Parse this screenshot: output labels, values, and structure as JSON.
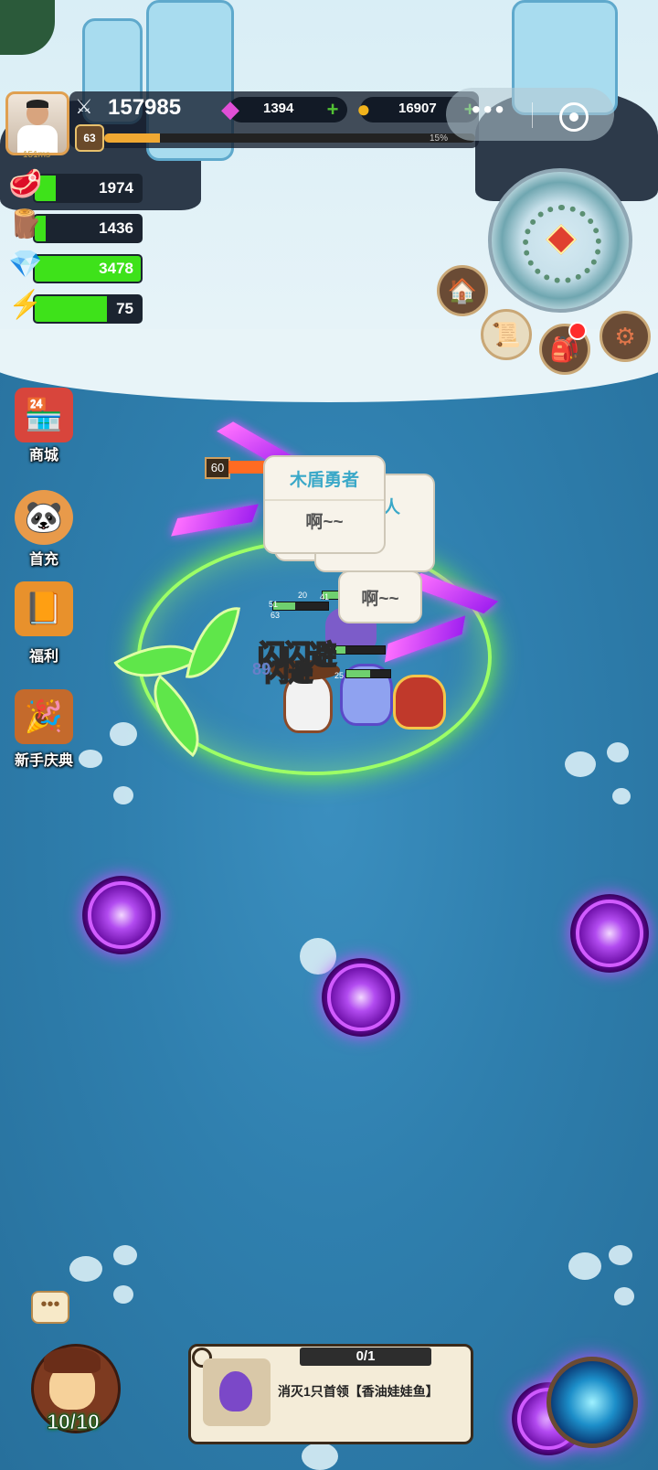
{
  "player": {
    "ping": "151ms",
    "power": "157985",
    "level": "63",
    "xp_percent_label": "15%",
    "xp_fraction": 0.15
  },
  "currencies": {
    "gems": "1394",
    "coins": "16907"
  },
  "resources": [
    {
      "icon": "meat-icon",
      "value": "1974",
      "fill": 0.2
    },
    {
      "icon": "wood-log-icon",
      "value": "1436",
      "fill": 0.1
    },
    {
      "icon": "crystal-icon",
      "value": "3478",
      "fill": 1.0
    },
    {
      "icon": "energy-bolt-icon",
      "value": "75",
      "fill": 0.68
    }
  ],
  "side_menu": [
    {
      "icon": "shop-stall-icon",
      "label": "商城"
    },
    {
      "icon": "first-recharge-icon",
      "label": "首充"
    },
    {
      "icon": "welfare-book-icon",
      "label": "福利"
    },
    {
      "icon": "newbie-festival-icon",
      "label": "新手庆典"
    }
  ],
  "battle": {
    "enemy_level": "60",
    "bubble1": {
      "name": "木盾勇者",
      "text": "啊~~"
    },
    "bubble2": {
      "name": "猎人",
      "text": "~"
    },
    "bubble3": {
      "text": "啊~~"
    },
    "dodge_text_1": "闪闪避",
    "dodge_text_2": "闪避",
    "damage": "89",
    "hp_numbers": [
      "51",
      "63",
      "41",
      "20",
      "10",
      "25"
    ]
  },
  "bottom": {
    "hero_count": "10/10",
    "quest_progress": "0/1",
    "quest_text": "消灭1只首领【香油娃娃鱼】"
  },
  "colors": {
    "resource_fill": "#3ee21a",
    "xp_fill": "#f0a832",
    "portal": "#b24bf0"
  }
}
